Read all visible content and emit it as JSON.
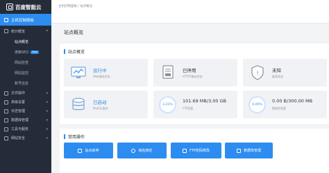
{
  "logo": {
    "text": "百度智能云"
  },
  "sidebar": {
    "top_item": "主机控制面板",
    "overview_group": "统计概览",
    "sub_items": [
      {
        "label": "站点概览"
      },
      {
        "label": "搜索SEO",
        "badge": "New"
      },
      {
        "label": "网站检查"
      },
      {
        "label": "网站监控"
      },
      {
        "label": "账号信息"
      }
    ],
    "groups": [
      {
        "label": "文件操作"
      },
      {
        "label": "高级设置"
      },
      {
        "label": "日志管理"
      },
      {
        "label": "数据库管理"
      },
      {
        "label": "工具与服务"
      },
      {
        "label": "网站安全"
      }
    ]
  },
  "header": {
    "breadcrumb": "主机控制面板 / 站点概览"
  },
  "page": {
    "title": "站点概览"
  },
  "overview": {
    "title": "站点概览",
    "cards": [
      {
        "value": "运行中",
        "label": "Web服务状态",
        "icon": "monitor-icon"
      },
      {
        "value": "已停用",
        "label": "HTTPS服务状态",
        "icon": "certificate-icon"
      },
      {
        "value": "未知",
        "label": "备案状态",
        "icon": "shield-icon"
      },
      {
        "value": "已启动",
        "label": "MySQL服务",
        "icon": "database-icon"
      },
      {
        "value": "101.69 MB/3.00 GB",
        "label": "FTP容量",
        "percent_text": "3.31%",
        "icon": "ring"
      },
      {
        "value": "0.00 B/300.00 MB",
        "label": "数据库容量",
        "percent_text": "0.00%",
        "icon": "ring"
      }
    ]
  },
  "operations": {
    "title": "常用操作",
    "buttons": [
      {
        "label": "站点启停",
        "icon": "power-icon"
      },
      {
        "label": "域名绑定",
        "icon": "globe-icon"
      },
      {
        "label": "FTP密码修改",
        "icon": "key-icon"
      },
      {
        "label": "数据库管理",
        "icon": "database-icon"
      }
    ]
  },
  "colors": {
    "accent": "#2d8cf0",
    "sidebar": "#252c39",
    "card_bg": "#f0f2f5"
  }
}
